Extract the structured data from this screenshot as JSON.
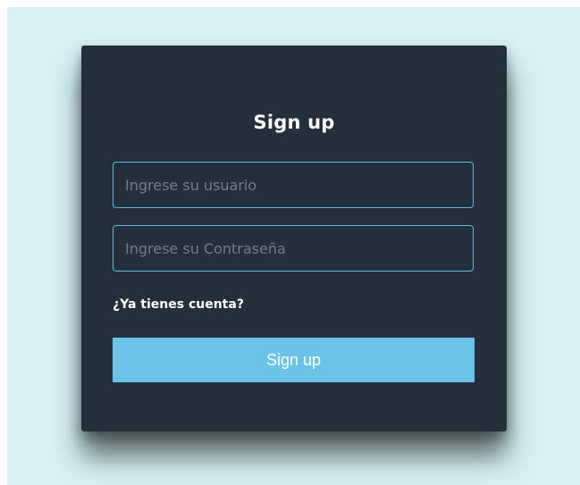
{
  "form": {
    "title": "Sign up",
    "username": {
      "value": "",
      "placeholder": "Ingrese su usuario"
    },
    "password": {
      "value": "",
      "placeholder": "Ingrese su Contraseña"
    },
    "login_link": "¿Ya tienes cuenta?",
    "submit_label": "Sign up"
  },
  "colors": {
    "page_background": "#d5f1f4",
    "card_background": "#242f3b",
    "input_border": "#61b9df",
    "button_background": "#6bc4e8",
    "text": "#ffffff"
  }
}
